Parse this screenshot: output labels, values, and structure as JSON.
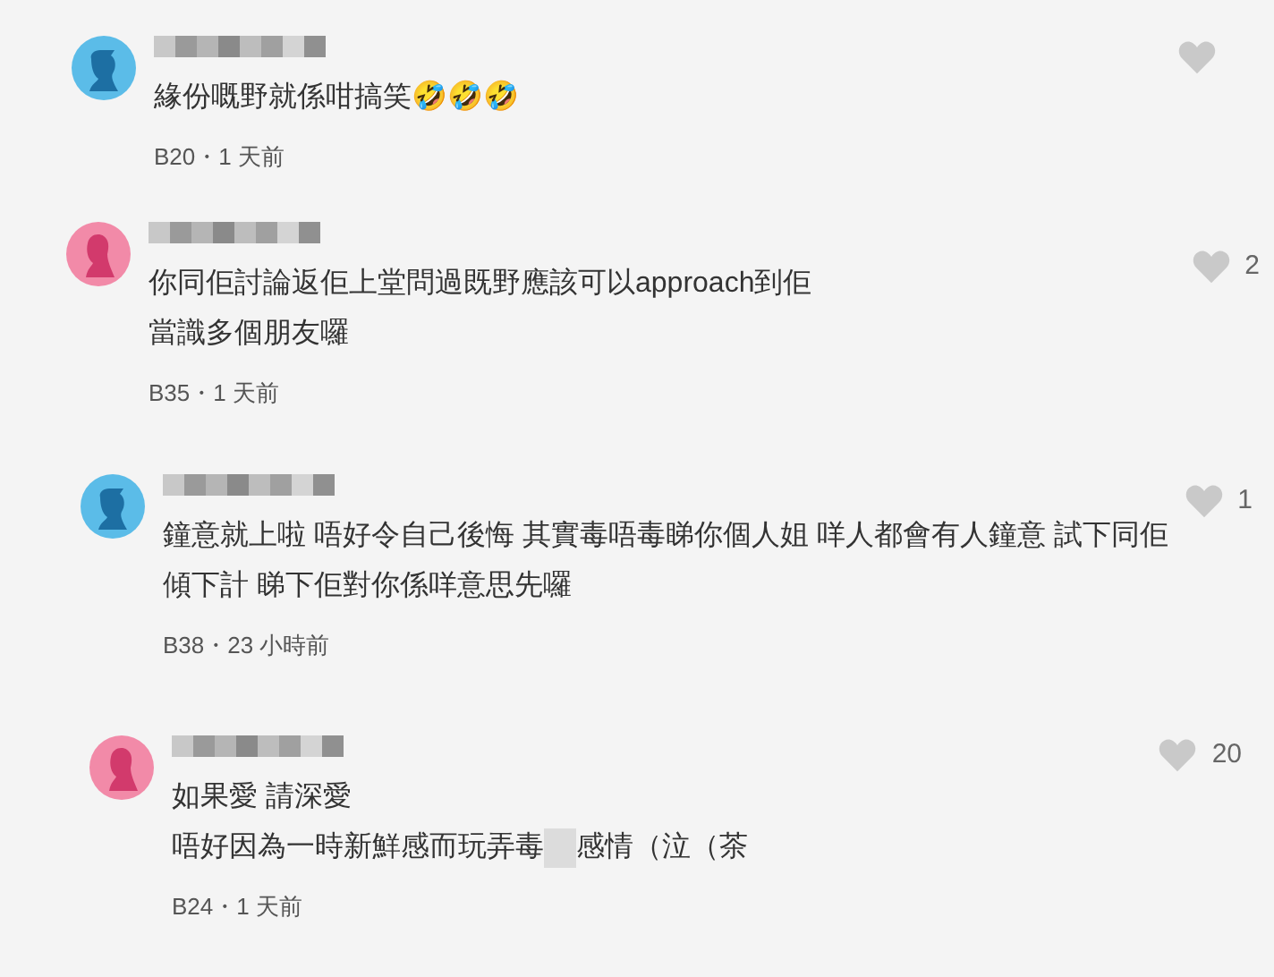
{
  "comments": [
    {
      "avatar": {
        "kind": "short-hair",
        "color": "#5bbce8"
      },
      "lines": [
        {
          "segments": [
            {
              "kind": "text",
              "text": "緣份嘅野就係咁搞笑🤣🤣🤣"
            }
          ]
        }
      ],
      "meta": "B20・1 天前"
    },
    {
      "avatar": {
        "kind": "long-hair",
        "color": "#f28aa8"
      },
      "lines": [
        {
          "segments": [
            {
              "kind": "text",
              "text": "你同佢討論返佢上堂問過既野應該可以approach到佢"
            }
          ]
        },
        {
          "segments": [
            {
              "kind": "text",
              "text": "當識多個朋友囉"
            }
          ]
        }
      ],
      "meta": "B35・1 天前",
      "likes": "2"
    },
    {
      "avatar": {
        "kind": "short-hair",
        "color": "#5bbce8"
      },
      "lines": [
        {
          "segments": [
            {
              "kind": "text",
              "text": "鐘意就上啦 唔好令自己後悔 其實毒唔毒睇你個人姐 咩人都會有人鐘意 試下同佢"
            }
          ]
        },
        {
          "segments": [
            {
              "kind": "text",
              "text": "傾下計 睇下佢對你係咩意思先囉"
            }
          ]
        }
      ],
      "meta": "B38・23 小時前",
      "likes": "1"
    },
    {
      "avatar": {
        "kind": "long-hair",
        "color": "#f28aa8"
      },
      "lines": [
        {
          "segments": [
            {
              "kind": "text",
              "text": "如果愛 請深愛"
            }
          ]
        },
        {
          "segments": [
            {
              "kind": "text",
              "text": "唔好因為一時新鮮感而玩弄毒"
            },
            {
              "kind": "redacted"
            },
            {
              "kind": "text",
              "text": "感情（泣（茶"
            }
          ]
        }
      ],
      "meta": "B24・1 天前",
      "likes": "20"
    }
  ]
}
